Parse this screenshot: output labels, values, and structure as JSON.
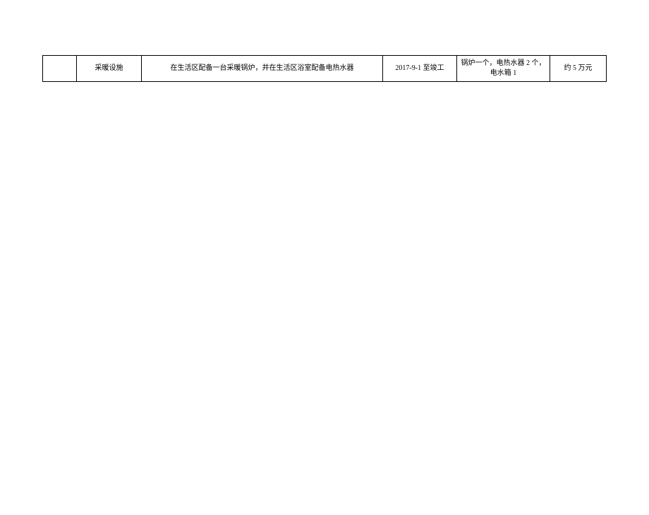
{
  "table": {
    "rows": [
      {
        "col1": "",
        "col2": "采暖设施",
        "col3": "在生活区配备一台采暖锅炉，并在生活区浴室配备电热水器",
        "col4": "2017-9-1 至竣工",
        "col5": "锅炉一个，电热水器 2 个，电水箱 1",
        "col6": "约 5 万元"
      }
    ]
  }
}
